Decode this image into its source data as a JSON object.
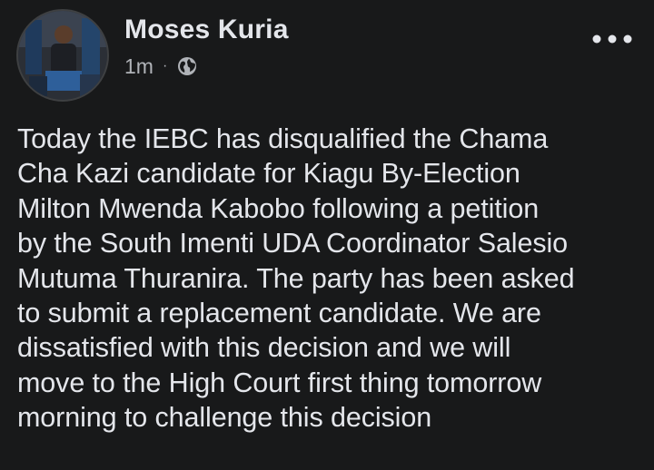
{
  "post": {
    "author": "Moses Kuria",
    "time": "1m",
    "separator": "·",
    "audience_icon": "globe-icon",
    "more_icon": "more-options-icon",
    "text": "Today the IEBC has disqualified the Chama\nCha Kazi candidate for Kiagu By-Election\nMilton Mwenda Kabobo following a petition\nby the South Imenti UDA Coordinator Salesio\nMutuma Thuranira. The party has been asked\nto submit a replacement candidate.  We are\ndissatisfied with this decision and we will\nmove to the High Court first thing tomorrow\nmorning to challenge this decision"
  },
  "colors": {
    "background": "#18191a",
    "primary_text": "#e4e6eb",
    "secondary_text": "#b0b3b8"
  }
}
